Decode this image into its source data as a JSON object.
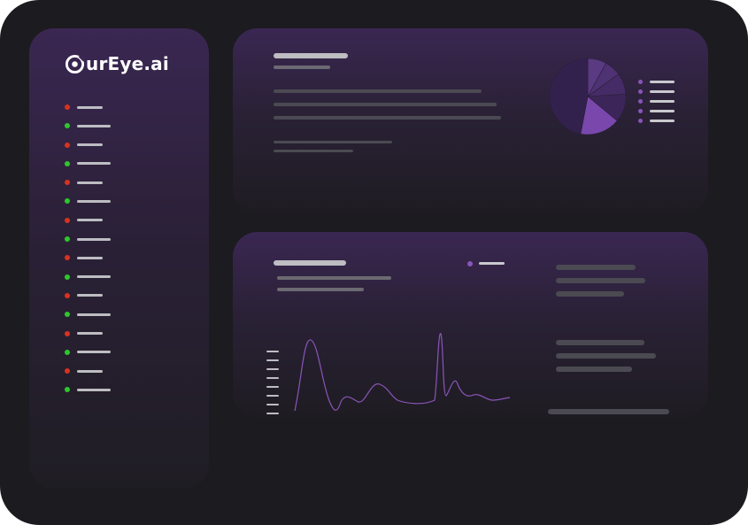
{
  "brand": {
    "name": "urEye.ai",
    "accent": "#8a55b8",
    "status_red": "#d8321f",
    "status_green": "#2cc82a"
  },
  "sidebar": {
    "items": [
      {
        "status": "red"
      },
      {
        "status": "green"
      },
      {
        "status": "red"
      },
      {
        "status": "green"
      },
      {
        "status": "red"
      },
      {
        "status": "green"
      },
      {
        "status": "red"
      },
      {
        "status": "green"
      },
      {
        "status": "red"
      },
      {
        "status": "green"
      },
      {
        "status": "red"
      },
      {
        "status": "green"
      },
      {
        "status": "red"
      },
      {
        "status": "green"
      },
      {
        "status": "red"
      },
      {
        "status": "green"
      }
    ]
  },
  "overview_card": {
    "pie_slices": [
      8,
      7,
      9,
      12,
      17,
      47
    ],
    "pie_colors": [
      "#5a3a82",
      "#4e3273",
      "#452c66",
      "#3c2659",
      "#7a48ad",
      "#33214d"
    ],
    "legend_count": 5
  },
  "trend_card": {
    "series_color": "#8a55b8",
    "legend_count": 1
  }
}
